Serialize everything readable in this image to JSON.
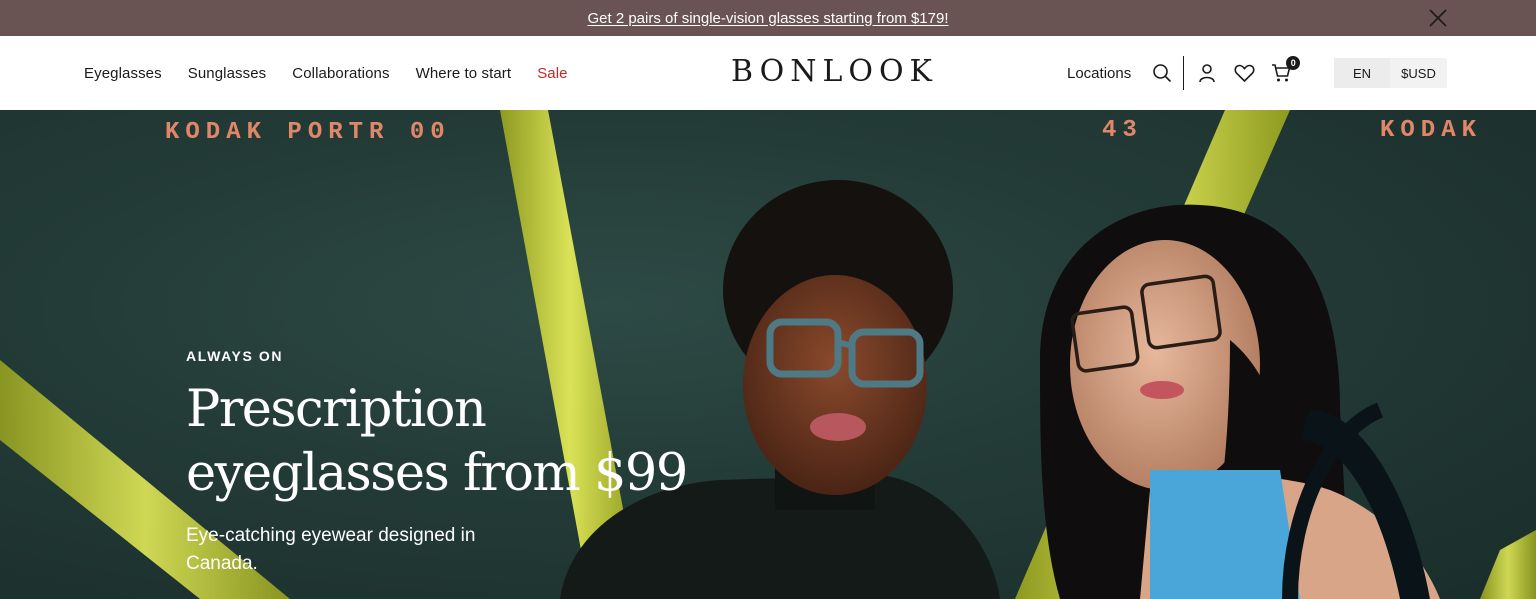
{
  "announcement": {
    "text": "Get 2 pairs of single-vision glasses starting from $179!"
  },
  "nav": {
    "left": [
      "Eyeglasses",
      "Sunglasses",
      "Collaborations",
      "Where to start",
      "Sale"
    ],
    "logo": "BONLOOK",
    "locations": "Locations",
    "cart_count": "0",
    "language": "EN",
    "currency": "$USD"
  },
  "hero": {
    "eyebrow": "ALWAYS ON",
    "headline": "Prescription eyeglasses from $99",
    "subtext": "Eye-catching eyewear designed in Canada.",
    "film_text_left": "KODAK  PORTR  00",
    "film_number": "43",
    "film_text_right": "KODAK"
  },
  "icons": {
    "close": "close-icon",
    "search": "search-icon",
    "account": "user-icon",
    "wishlist": "heart-icon",
    "cart": "cart-icon"
  },
  "colors": {
    "announcement_bg": "#6a5353",
    "sale": "#c62828",
    "hero_bg": "#233b37",
    "neon": "#d7e63a"
  }
}
